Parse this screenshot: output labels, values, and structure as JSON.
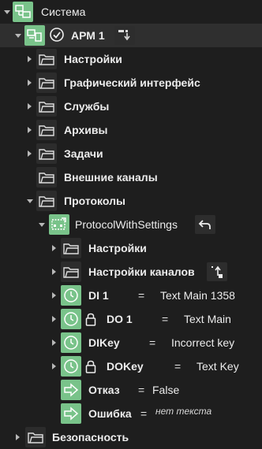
{
  "tree": {
    "root": {
      "label": "Система",
      "icon": "network-icon"
    },
    "arm": {
      "label": "АРМ 1",
      "icon": "workstation-icon"
    },
    "arm_children": [
      {
        "label": "Настройки"
      },
      {
        "label": "Графический интерфейс"
      },
      {
        "label": "Службы"
      },
      {
        "label": "Архивы"
      },
      {
        "label": "Задачи"
      },
      {
        "label": "Внешние каналы"
      },
      {
        "label": "Протоколы"
      }
    ],
    "protocol": {
      "label": "ProtocolWithSettings"
    },
    "protocol_folders": [
      {
        "label": "Настройки"
      },
      {
        "label": "Настройки каналов"
      }
    ],
    "channels": [
      {
        "name": "DI 1",
        "eq": "=",
        "value": "Text Main 1358",
        "locked": false
      },
      {
        "name": "DO 1",
        "eq": "=",
        "value": "Text Main",
        "locked": true
      },
      {
        "name": "DIKey",
        "eq": "=",
        "value": "Incorrect key",
        "locked": false
      },
      {
        "name": "DOKey",
        "eq": "=",
        "value": "Text Key",
        "locked": true
      }
    ],
    "outputs": [
      {
        "name": "Отказ",
        "eq": "=",
        "value": "False"
      },
      {
        "name": "Ошибка",
        "eq": "=",
        "value": "нет текста"
      }
    ],
    "security": {
      "label": "Безопасность"
    }
  },
  "colors": {
    "accent_green": "#79c38a",
    "background": "#1e1e1e",
    "selected_row": "#2f2f2f"
  }
}
